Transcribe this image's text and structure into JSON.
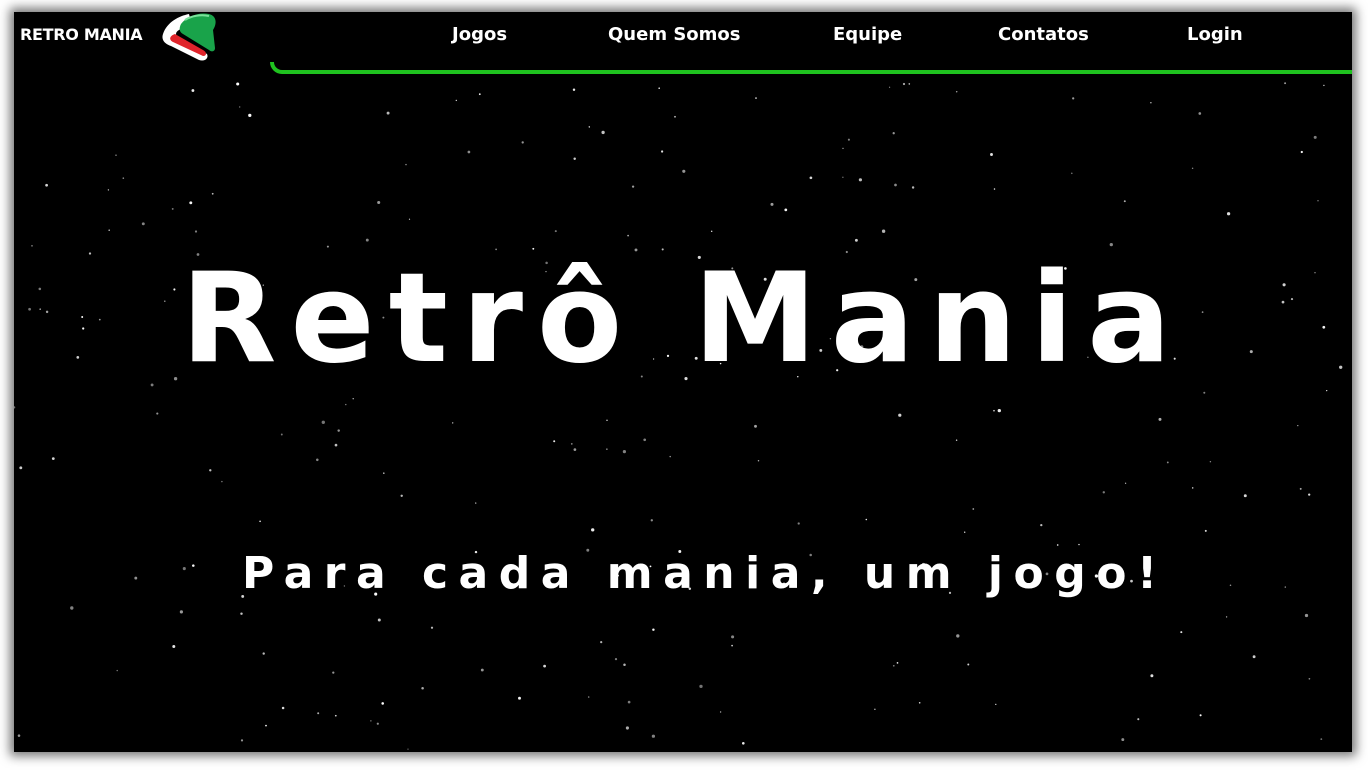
{
  "brand": {
    "name": "RETRO MANIA",
    "logo_icon": "retro-mania-logo-icon"
  },
  "nav": {
    "links": [
      {
        "label": "Jogos"
      },
      {
        "label": "Quem Somos"
      },
      {
        "label": "Equipe"
      },
      {
        "label": "Contatos"
      },
      {
        "label": "Login"
      }
    ]
  },
  "hero": {
    "title": "Retrô Mania",
    "subtitle": "Para cada mania, um jogo!"
  },
  "colors": {
    "background": "#000000",
    "text": "#ffffff",
    "accent_green": "#1fc21f",
    "logo_red": "#e0242b",
    "logo_green": "#19a34a"
  }
}
